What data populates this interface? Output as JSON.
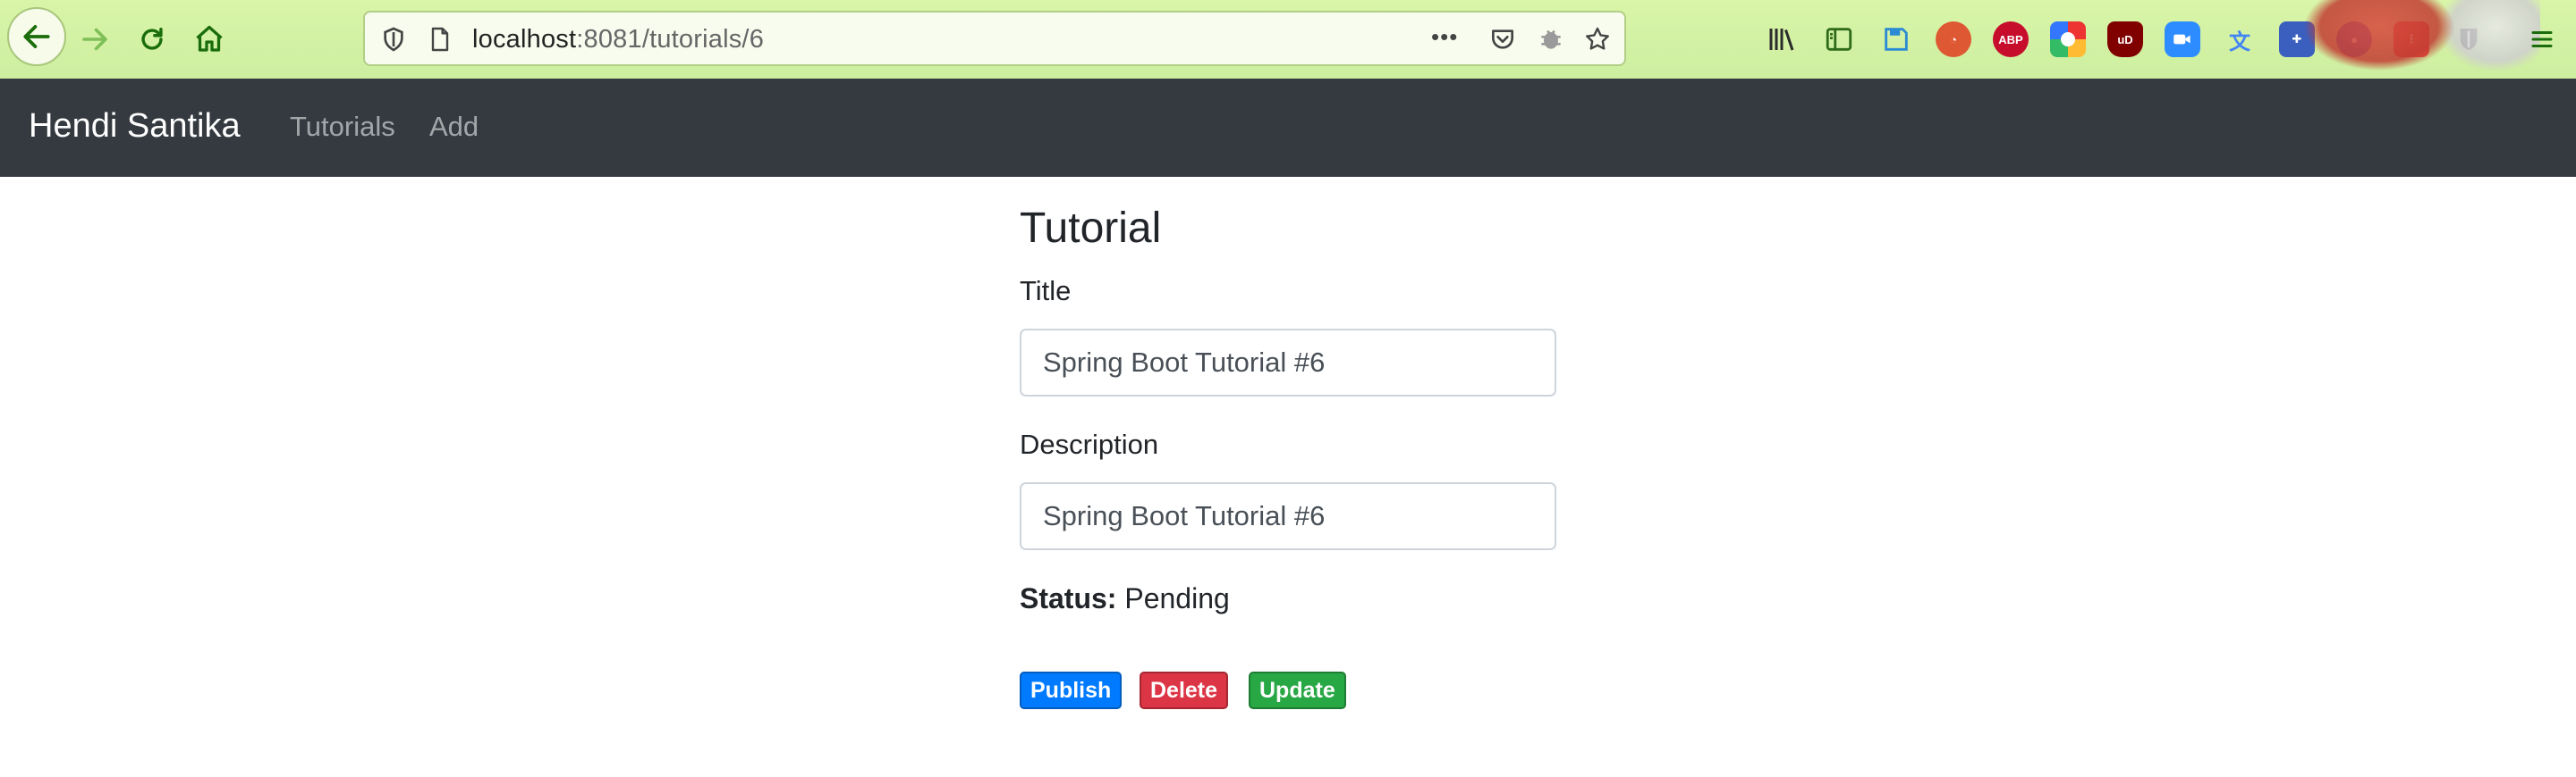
{
  "browser": {
    "url_host": "localhost",
    "url_path": ":8081/tutorials/6",
    "page_actions_glyph": "•••",
    "toolbar_icons": [
      "back-icon",
      "forward-icon",
      "reload-icon",
      "home-icon"
    ],
    "extensions": [
      {
        "name": "library-icon",
        "color": "#2b2b2b"
      },
      {
        "name": "sidebar-icon",
        "color": "#2e6b1a"
      },
      {
        "name": "save-icon",
        "color": "#2a8ad4"
      },
      {
        "name": "duckduckgo-icon",
        "color": "#de5833"
      },
      {
        "name": "abp-icon",
        "text": "ABP",
        "color": "#c70d2c"
      },
      {
        "name": "color-picker-icon",
        "color": "#6b3fd4"
      },
      {
        "name": "ublock-icon",
        "text": "uD",
        "color": "#800000"
      },
      {
        "name": "zoom-icon",
        "color": "#2d8cff"
      },
      {
        "name": "translate-icon",
        "color": "#4285f4"
      },
      {
        "name": "extension-puzzle-icon",
        "color": "#3a5fbf"
      },
      {
        "name": "privacy-icon",
        "color": "#6f6fa8"
      },
      {
        "name": "tree-style-icon",
        "color": "#e24a3b"
      },
      {
        "name": "bitwarden-icon",
        "color": "#333333"
      }
    ]
  },
  "navbar": {
    "brand": "Hendi Santika",
    "links": [
      "Tutorials",
      "Add"
    ],
    "background": "#343a40"
  },
  "tutorial": {
    "heading": "Tutorial",
    "title_label": "Title",
    "title_value": "Spring Boot Tutorial #6",
    "description_label": "Description",
    "description_value": "Spring Boot Tutorial #6",
    "status_label": "Status:",
    "status_value": "Pending"
  },
  "actions": {
    "publish": {
      "label": "Publish",
      "color": "#007bff"
    },
    "delete": {
      "label": "Delete",
      "color": "#dc3545"
    },
    "update": {
      "label": "Update",
      "color": "#28a745"
    }
  }
}
